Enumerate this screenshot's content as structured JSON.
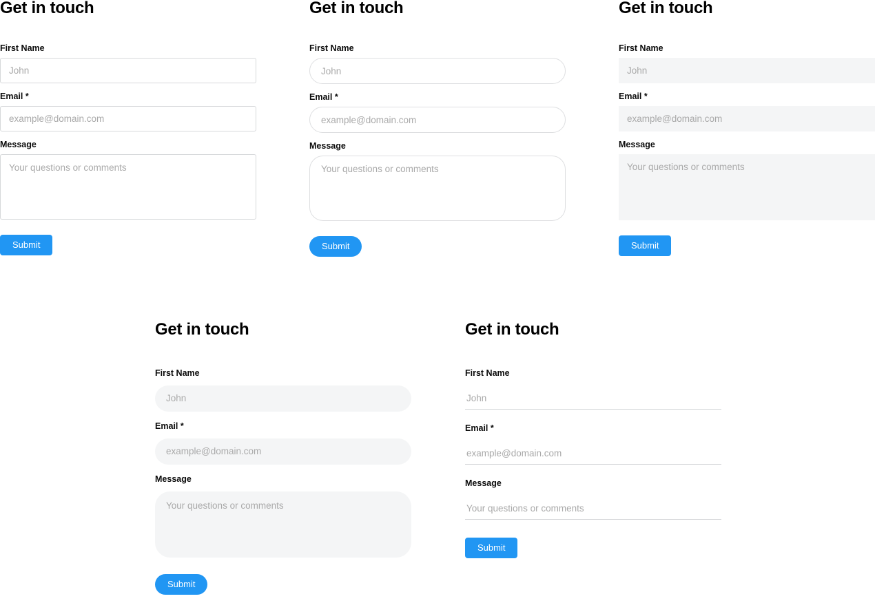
{
  "page": {
    "accent_color": "#2196f3",
    "filled_bg": "#f4f5f6",
    "border_color": "#d6d8da",
    "placeholder_color": "#a9a9a9"
  },
  "shared": {
    "title": "Get in touch",
    "labels": {
      "first_name": "First Name",
      "email": "Email *",
      "message": "Message"
    },
    "placeholders": {
      "first_name": "John",
      "email": "example@domain.com",
      "message": "Your questions or comments"
    },
    "submit_label": "Submit"
  },
  "forms": [
    {
      "id": "form-1",
      "variant": "outline",
      "title": "Get in touch",
      "fields": [
        {
          "label": "First Name",
          "placeholder": "John",
          "value": "",
          "type": "text"
        },
        {
          "label": "Email *",
          "placeholder": "example@domain.com",
          "value": "",
          "type": "email"
        },
        {
          "label": "Message",
          "placeholder": "Your questions or comments",
          "value": "",
          "type": "textarea"
        }
      ],
      "submit_label": "Submit"
    },
    {
      "id": "form-2",
      "variant": "pill",
      "title": "Get in touch",
      "fields": [
        {
          "label": "First Name",
          "placeholder": "John",
          "value": "",
          "type": "text"
        },
        {
          "label": "Email *",
          "placeholder": "example@domain.com",
          "value": "",
          "type": "email"
        },
        {
          "label": "Message",
          "placeholder": "Your questions or comments",
          "value": "",
          "type": "textarea"
        }
      ],
      "submit_label": "Submit"
    },
    {
      "id": "form-3",
      "variant": "filled",
      "title": "Get in touch",
      "fields": [
        {
          "label": "First Name",
          "placeholder": "John",
          "value": "",
          "type": "text"
        },
        {
          "label": "Email *",
          "placeholder": "example@domain.com",
          "value": "",
          "type": "email"
        },
        {
          "label": "Message",
          "placeholder": "Your questions or comments",
          "value": "",
          "type": "textarea"
        }
      ],
      "submit_label": "Submit"
    },
    {
      "id": "form-4",
      "variant": "filled-pill",
      "title": "Get in touch",
      "fields": [
        {
          "label": "First Name",
          "placeholder": "John",
          "value": "",
          "type": "text"
        },
        {
          "label": "Email *",
          "placeholder": "example@domain.com",
          "value": "",
          "type": "email"
        },
        {
          "label": "Message",
          "placeholder": "Your questions or comments",
          "value": "",
          "type": "textarea"
        }
      ],
      "submit_label": "Submit"
    },
    {
      "id": "form-5",
      "variant": "underline",
      "title": "Get in touch",
      "fields": [
        {
          "label": "First Name",
          "placeholder": "John",
          "value": "",
          "type": "text"
        },
        {
          "label": "Email *",
          "placeholder": "example@domain.com",
          "value": "",
          "type": "email"
        },
        {
          "label": "Message",
          "placeholder": "Your questions or comments",
          "value": "",
          "type": "textarea"
        }
      ],
      "submit_label": "Submit"
    }
  ]
}
